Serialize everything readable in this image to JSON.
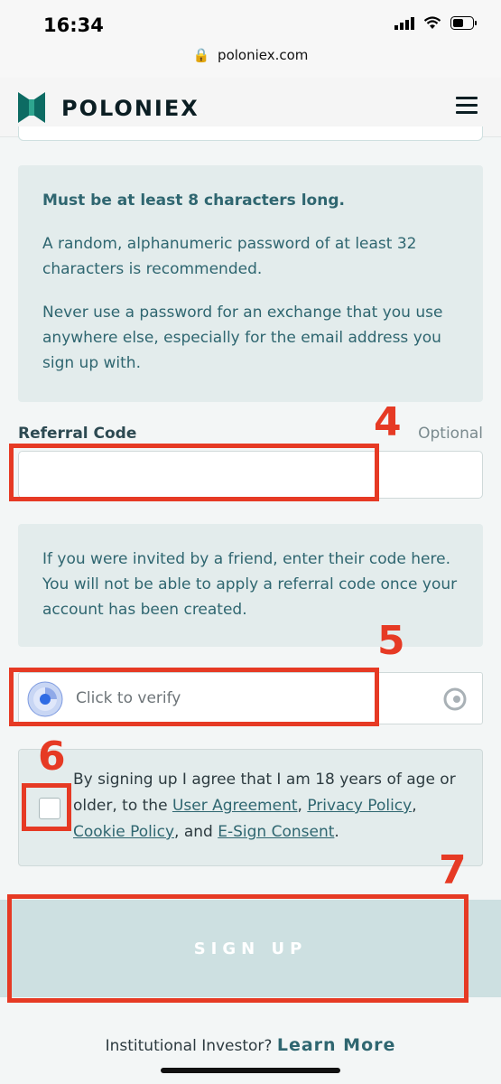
{
  "status_bar": {
    "time": "16:34"
  },
  "browser": {
    "url": "poloniex.com"
  },
  "header": {
    "brand": "POLONIEX"
  },
  "password_hint": {
    "requirement": "Must be at least 8 characters long.",
    "recommendation": "A random, alphanumeric password of at least 32 characters is recommended.",
    "warning": "Never use a password for an exchange that you use anywhere else, especially for the email address you sign up with."
  },
  "referral": {
    "label": "Referral Code",
    "optional": "Optional",
    "value": "",
    "hint": "If you were invited by a friend, enter their code here. You will not be able to apply a referral code once your account has been created."
  },
  "captcha": {
    "label": "Click to verify"
  },
  "terms": {
    "prefix": "By signing up I agree that I am 18 years of age or older, to the",
    "user_agreement": "User Agreement",
    "privacy_policy": "Privacy Policy",
    "cookie_policy": "Cookie Policy",
    "and": ", and",
    "esign": "E-Sign Consent",
    "checked": false
  },
  "signup_button": "SIGN UP",
  "footer": {
    "question": "Institutional Investor?",
    "link": "Learn More"
  },
  "annotations": {
    "n4": "4",
    "n5": "5",
    "n6": "6",
    "n7": "7"
  },
  "colors": {
    "accent": "#2f6670",
    "annotation": "#e63a24",
    "button_bg": "#cde0e1"
  }
}
